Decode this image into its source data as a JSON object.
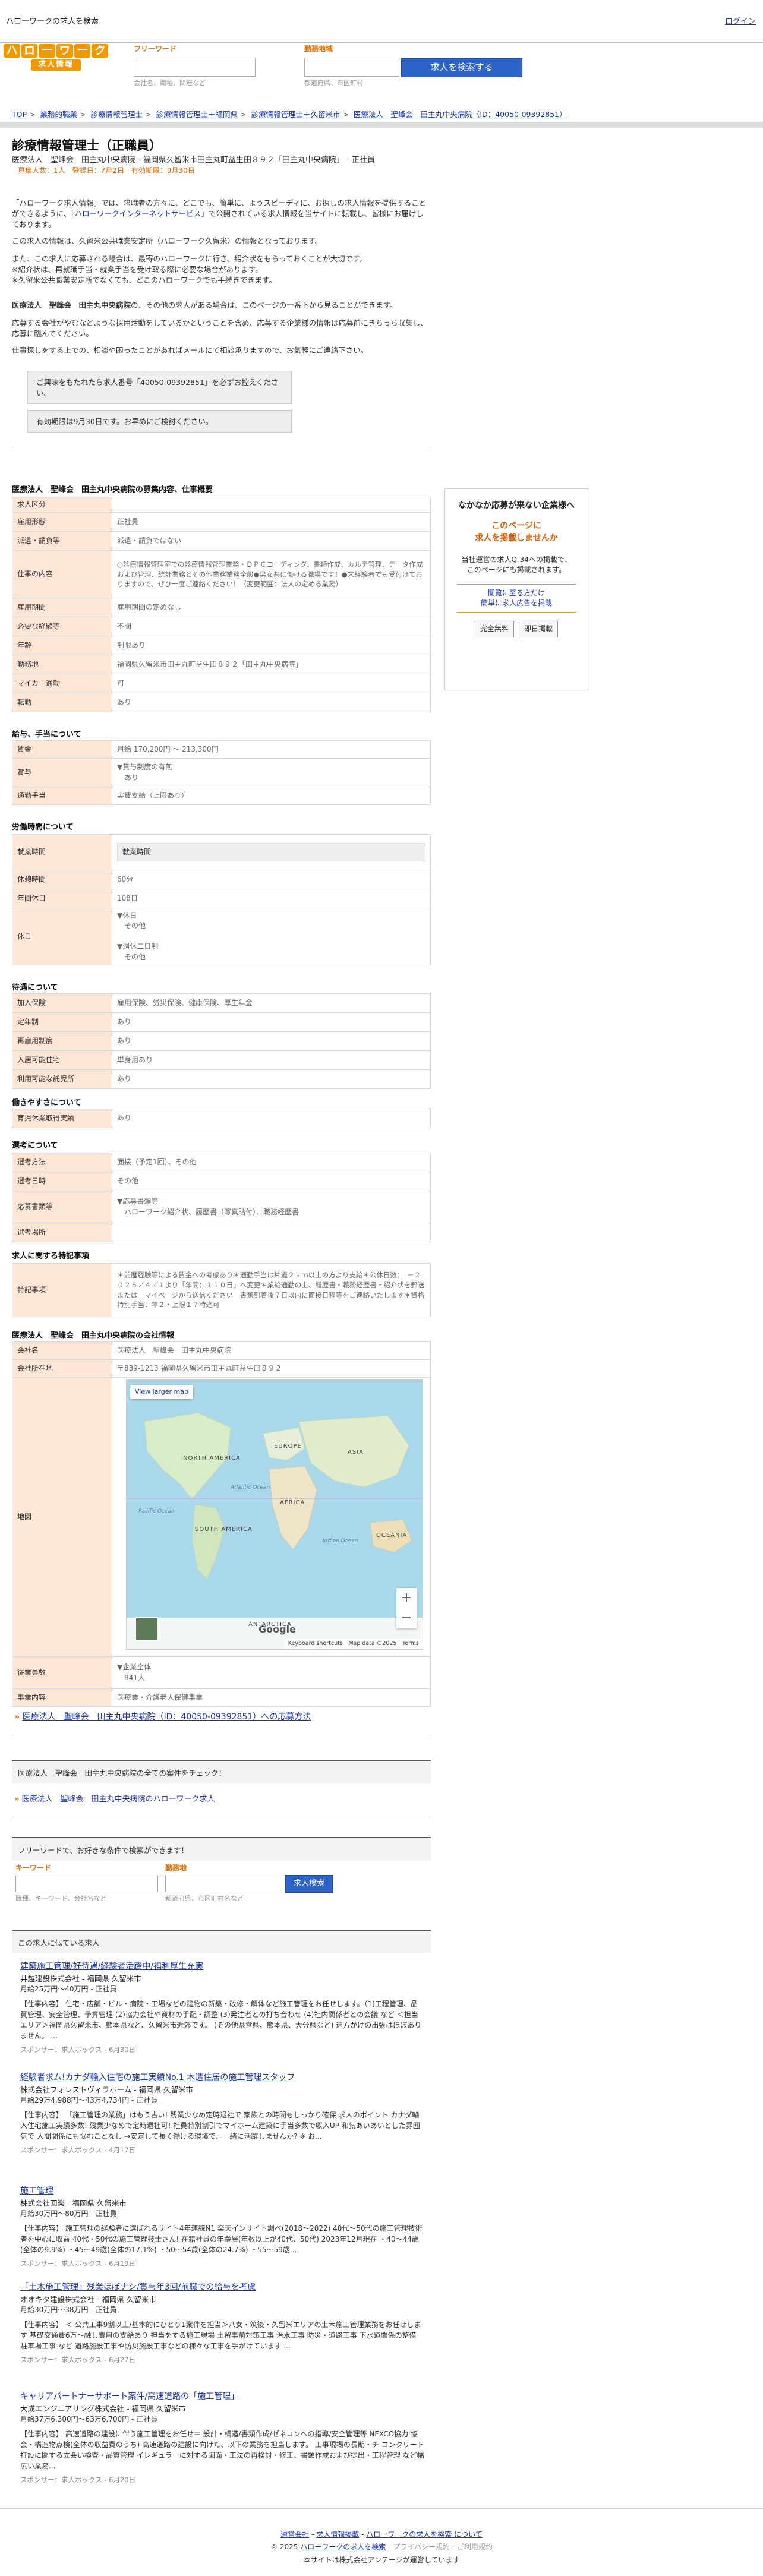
{
  "topbar": {
    "site": "ハローワークの求人を検索",
    "login": "ログイン"
  },
  "logo": {
    "chars": [
      "ハ",
      "ロ",
      "ー",
      "ワ",
      "ー",
      "ク"
    ],
    "sub": "求人情報",
    "color": "#f39800"
  },
  "search": {
    "keyword_label": "フリーワード",
    "keyword_hint": "会社名、職種、関連など",
    "area_label": "勤務地域",
    "area_hint": "都道府県、市区町村",
    "button": "求人を検索する"
  },
  "breadcrumb": [
    "TOP",
    "業務的職業",
    "診療情報管理士",
    "診療情報管理士＋福岡県",
    "診療情報管理士＋久留米市",
    "医療法人　聖峰会　田主丸中央病院（ID：40050-09392851）"
  ],
  "job": {
    "title": "診療情報管理士（正職員）",
    "subinfo": "医療法人　聖峰会　田主丸中央病院 - 福岡県久留米市田主丸町益生田８９２「田主丸中央病院」 - 正社員",
    "subinfo2": "募集人数：1人　登録日：7月2日　有効期限：9月30日"
  },
  "intro": {
    "p1a": "「ハローワーク求人情報」では、求職者の方々に、どこでも、簡単に、ようスピーディに、お探しの求人情報を提供することができるように、「",
    "p1link": "ハローワークインターネットサービス",
    "p1b": "」で公開されている求人情報を当サイトに転載し、皆様にお届けしております。",
    "p2": "この求人の情報は、久留米公共職業安定所（ハローワーク久留米）の情報となっております。",
    "p3": "また、この求人に応募される場合は、最寄のハローワークに行き、紹介状をもらっておくことが大切です。",
    "p4": "※紹介状は、再就職手当・就業手当を受け取る際に必要な場合があります。",
    "p5": "※久留米公共職業安定所でなくても、どこのハローワークでも手続きできます。",
    "p6a": "医療法人　聖峰会　田主丸中央病院",
    "p6b": "の、その他の求人がある場合は、このページの一番下から見ることができます。",
    "p7": "応募する会社がやむなどような採用活動をしているかということを含め、応募する企業様の情報は応募前にきちっち収集し、応募に臨んでください。",
    "p8": "仕事探しをする上での、相談や困ったことがあればメールにて相談承りますので、お気軽にご連絡下さい。"
  },
  "notice": {
    "l1": "ご興味をもたれたら求人番号「40050-09392851」を必ずお控えください。",
    "l2": "有効期限は9月30日です。お早めにご検討ください。"
  },
  "sections": {
    "recruit": "医療法人　聖峰会　田主丸中央病院の募集内容、仕事概要",
    "pay": "給与、手当について",
    "hours": "労働時間について",
    "treatment": "待遇について",
    "ease": "働きやすさについて",
    "selection": "選考について",
    "special": "求人に関する特記事項",
    "company": "医療法人　聖峰会　田主丸中央病院の会社情報"
  },
  "recruit_rows": [
    {
      "k": "求人区分",
      "v": ""
    },
    {
      "k": "雇用形態",
      "v": "正社員"
    },
    {
      "k": "派遣・請負等",
      "v": "派遣・請負ではない"
    },
    {
      "k": "仕事の内容",
      "v": "○診療情報管理室での診療情報管理業務・ＤＰＣコーディング、書類作成、カルテ管理、データ作成および管理、統計業務とその他業務業務全般●男女共に働ける職場です！●未経験者でも受付けておりますので、ぜひ一度ご連絡ください！（変更範囲：法人の定める業務）"
    },
    {
      "k": "雇用期間",
      "v": "雇用期間の定めなし"
    },
    {
      "k": "必要な経験等",
      "v": "不問"
    },
    {
      "k": "年齢",
      "v": "制限あり"
    },
    {
      "k": "勤務地",
      "v": "福岡県久留米市田主丸町益生田８９２「田主丸中央病院」"
    },
    {
      "k": "マイカー通勤",
      "v": "可"
    },
    {
      "k": "転勤",
      "v": "あり"
    }
  ],
  "pay_rows": [
    {
      "k": "賃金",
      "v": "月給 170,200円 〜 213,300円"
    },
    {
      "k": "賞与",
      "v": "▼賞与制度の有無\n　あり"
    },
    {
      "k": "通勤手当",
      "v": "実費支給（上限あり）"
    }
  ],
  "hours_rows": [
    {
      "k": "就業時間",
      "v": "就業時間"
    },
    {
      "k": "休憩時間",
      "v": "60分"
    },
    {
      "k": "年間休日",
      "v": "108日"
    },
    {
      "k": "休日",
      "v": "▼休日\n　その他\n\n▼週休二日制\n　その他"
    }
  ],
  "treat_rows": [
    {
      "k": "加入保険",
      "v": "雇用保険、労災保険、健康保険、厚生年金"
    },
    {
      "k": "定年制",
      "v": "あり"
    },
    {
      "k": "再雇用制度",
      "v": "あり"
    },
    {
      "k": "入居可能住宅",
      "v": "単身用あり"
    },
    {
      "k": "利用可能な託児所",
      "v": "あり"
    }
  ],
  "ease_rows": [
    {
      "k": "育児休業取得実績",
      "v": "あり"
    }
  ],
  "sel_rows": [
    {
      "k": "選考方法",
      "v": "面接（予定1回）、その他"
    },
    {
      "k": "選考日時",
      "v": "その他"
    },
    {
      "k": "応募書類等",
      "v": "▼応募書類等\n　ハローワーク紹介状、履歴書（写真貼付）、職務経歴書"
    },
    {
      "k": "選考場所",
      "v": ""
    }
  ],
  "special_rows": [
    {
      "k": "特記事項",
      "v": "＊前歴経験等による賃金への考慮あり＊通勤手当は片道２ｋｍ以上の方より支給＊公休日数：　－２０２６／４／１より「年間：１１０日」へ変更＊業給通勤の上、履歴書・職務経歴書・紹介状を郵送または　マイページから送信ください　書類到着後７日以内に面接日程等をご連絡いたします＊資格特別手当：年２・上限１７時迄可"
    }
  ],
  "company_rows": [
    {
      "k": "会社名",
      "v": "医療法人　聖峰会　田主丸中央病院"
    },
    {
      "k": "会社所在地",
      "v": "〒839-1213 福岡県久留米市田主丸町益生田８９２"
    },
    {
      "k": "地図",
      "v": ""
    },
    {
      "k": "従業員数",
      "v": "▼企業全体\n　841人"
    },
    {
      "k": "事業内容",
      "v": "医療業・介護老人保健事業"
    }
  ],
  "side": {
    "t1": "なかなか応募が来ない企業様へ",
    "t2": "このページに",
    "t3": "求人を掲載しませんか",
    "t4a": "当社運営の求人Q-34への掲載で、",
    "t4b": "このページにも掲載されます。",
    "a1": "閲覧に至る方だけ",
    "a2": "簡単に求人広告を掲載",
    "b1": "完全無料",
    "b2": "即日掲載"
  },
  "map": {
    "view_larger": "View larger map",
    "keyboard": "Keyboard shortcuts",
    "mapdata": "Map data ©2025",
    "terms": "Terms",
    "google": "Google",
    "labels": [
      "NORTH AMERICA",
      "SOUTH AMERICA",
      "EUROPE",
      "AFRICA",
      "ASIA",
      "OCEANIA",
      "ANTARCTICA",
      "Pacific Ocean",
      "Atlantic Ocean",
      "Indian Ocean"
    ]
  },
  "apply": "医療法人　聖峰会　田主丸中央病院（ID：40050-09392851）への応募方法",
  "check": {
    "title": "医療法人　聖峰会　田主丸中央病院の全ての案件をチェック！",
    "link": "医療法人　聖峰会　田主丸中央病院のハローワーク求人"
  },
  "search2": {
    "title": "フリーワードで、お好きな条件で検索ができます！",
    "kw": "キーワード",
    "area": "勤務地",
    "kw_hint": "職種、キーワード、会社名など",
    "area_hint": "都道府県、市区町村名など",
    "btn": "求人検索"
  },
  "similar_title": "この求人に似ている求人",
  "similar": [
    {
      "t": "建築施工管理/好待遇/経験者活躍中/福利厚生充実",
      "co": "井越建設株式会社 - 福岡県 久留米市",
      "sal": "月給25万円〜40万円 - 正社員",
      "d": "【仕事内容】 住宅・店舗・ビル・病院・工場などの建物の新築・改修・解体など施工管理をお任せします。（1)工程管理、品質管理、安全管理、予算管理 (2)協力会社や資材の手配・調整 (3)発注者との打ち合わせ (4)社内関係者との会議 など ＜担当エリア＞福岡県久留米市、熊本県など、久留米市近郊です。 (その他県営県、熊本県、大分県など) 遠方がけの出張はほぼありません。 ...",
      "sp": "スポンサー：求人ボックス - ",
      "date": "6月30日"
    },
    {
      "t": "経験者求ム!カナダ輸入住宅の施工実績No.1 木造住居の施工管理スタッフ",
      "co": "株式会社フォレストヴィラホーム - 福岡県 久留米市",
      "sal": "月給29万4,988円〜43万4,734円 - 正社員",
      "d": "【仕事内容】 「施工管理の業務」はもう古い! 残業少なめ定時退社で 家族との時間もしっかり確保 求人のポイント カナダ輸入住宅施工実績多数! 残業少なめで定時退社可! 社員特別割引でマイホーム建築に手当多数で収入UP 和気あいあいとした雰囲気で 人間関係にも悩むことなし →安定して長く働ける環境で、一緒に活躍しませんか? ※ お...",
      "sp": "スポンサー：求人ボックス - ",
      "date": "4月17日"
    },
    {
      "t": "施工管理",
      "co": "株式会社回楽 - 福岡県 久留米市",
      "sal": "月給30万円〜80万円 - 正社員",
      "d": "【仕事内容】 施工管理の経験者に選ばれるサイト4年連続N1 楽天インサイト調べ(2018〜2022) 40代〜50代の施工管理技術者を中心に収益 40代・50代の施工管理技士さん! 在籍社員の年齢層(年数以上が40代、50代) 2023年12月現在 ・40〜44歳(全体の9.9%) ・45〜49歳(全体の17.1%) ・50〜54歳(全体の24.7%) ・55〜59歳...",
      "sp": "スポンサー：求人ボックス - ",
      "date": "6月19日"
    },
    {
      "t": "「土木施工管理」残業ほぼナシ/賞与年3回/前職での給与を考慮",
      "co": "オオキタ建設株式会社 - 福岡県 久留米市",
      "sal": "月給30万円〜38万円 - 正社員",
      "d": "【仕事内容】 ＜ 公共工事9割以上/基本的にひとり1案件を担当＞八女・筑後・久留米エリアの土木施工管理業務をお任せします 基礎交通費6万〜融し費用の支給あり 担当をする施工現場 土留事前対策工事 治水工事 防災・道路工事 下水道関係の整備 駐車場工事 など 道路施設工事や防災施設工事などの様々な工事を手がけています ...",
      "sp": "スポンサー：求人ボックス - ",
      "date": "6月27日"
    },
    {
      "t": "キャリアパートナーサポート案件/高速道路の「施工管理」",
      "co": "大成エンジニアリング株式会社 - 福岡県 久留米市",
      "sal": "月給37万6,300円〜63万6,700円 - 正社員",
      "d": "【仕事内容】 高速道路の建設に伴う施工管理をお任せ＝ 設計・構造/書類作成/ゼネコンへの指導/安全管理等 NEXCO協力 協会・構造物点検(全体の収益費のうち) 高速道路の建設に向けた、以下の業務を担当します。 工事現場の長期・チ コンクリート打設に関する立会い検査・品質管理 イレギュラーに対する図面・工法の再検討・修正、書類作成および提出・工程管理 など幅広い業務...",
      "sp": "スポンサー：求人ボックス - ",
      "date": "6月20日"
    }
  ],
  "footer": {
    "l1a": "運営会社",
    "l1b": "求人情報掲載",
    "l1c": "ハローワークの求人を検索 について",
    "l2a": "© 2025 ",
    "l2b": "ハローワークの求人を検索",
    "l2c": " - プライバシー規約 - ご利用規約",
    "l3": "本サイトは株式会社アンテージが運営しています"
  }
}
